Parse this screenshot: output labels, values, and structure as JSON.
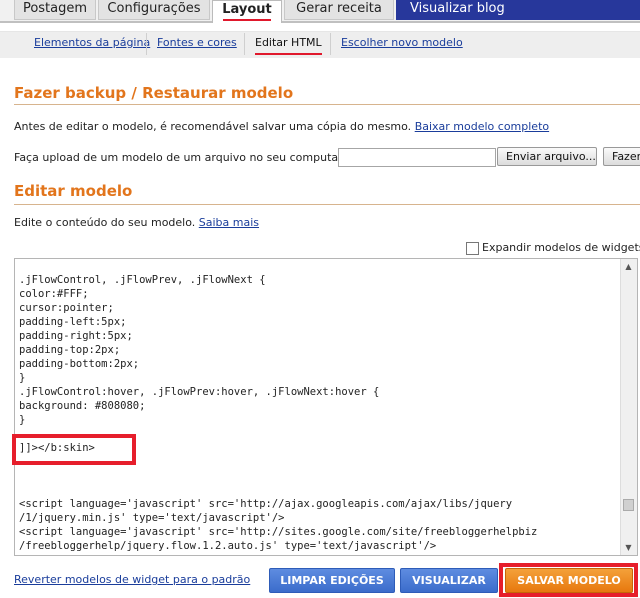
{
  "tabs": {
    "postagem": "Postagem",
    "config": "Configurações",
    "layout": "Layout",
    "gerar": "Gerar receita",
    "visualizar": "Visualizar blog"
  },
  "subtabs": {
    "elementos": "Elementos da página",
    "fontes": "Fontes e cores",
    "editar_html": "Editar HTML",
    "escolher": "Escolher novo modelo"
  },
  "backup": {
    "title": "Fazer backup / Restaurar modelo",
    "desc": "Antes de editar o modelo, é recomendável salvar uma cópia do mesmo.",
    "download_link": "Baixar modelo completo",
    "upload_label": "Faça upload de um modelo de um arquivo no seu computador:",
    "browse_button": "Enviar arquivo...",
    "upload_button": "Fazer upload"
  },
  "edit": {
    "title": "Editar modelo",
    "desc": "Edite o conteúdo do seu modelo.",
    "learn_more": "Saiba mais",
    "expand_label": "Expandir modelos de widgets",
    "code_lines": [
      ".jFlowControl, .jFlowPrev, .jFlowNext {",
      "color:#FFF;",
      "cursor:pointer;",
      "padding-left:5px;",
      "padding-right:5px;",
      "padding-top:2px;",
      "padding-bottom:2px;",
      "}",
      ".jFlowControl:hover, .jFlowPrev:hover, .jFlowNext:hover {",
      "background: #808080;",
      "}",
      "",
      "]]></b:skin>",
      "",
      "",
      "",
      "<script language='javascript' src='http://ajax.googleapis.com/ajax/libs/jquery",
      "/1/jquery.min.js' type='text/javascript'/>",
      "<script language='javascript' src='http://sites.google.com/site/freebloggerhelpbiz",
      "/freebloggerhelp/jquery.flow.1.2.auto.js' type='text/javascript'/>"
    ]
  },
  "footer": {
    "revert_link": "Reverter modelos de widget para o padrão",
    "clear": "LIMPAR EDIÇÕES",
    "preview": "VISUALIZAR",
    "save": "SALVAR MODELO"
  },
  "colors": {
    "accent_orange": "#e2751c",
    "link_blue": "#1a3d9b",
    "highlight_red": "#e61e2b"
  }
}
